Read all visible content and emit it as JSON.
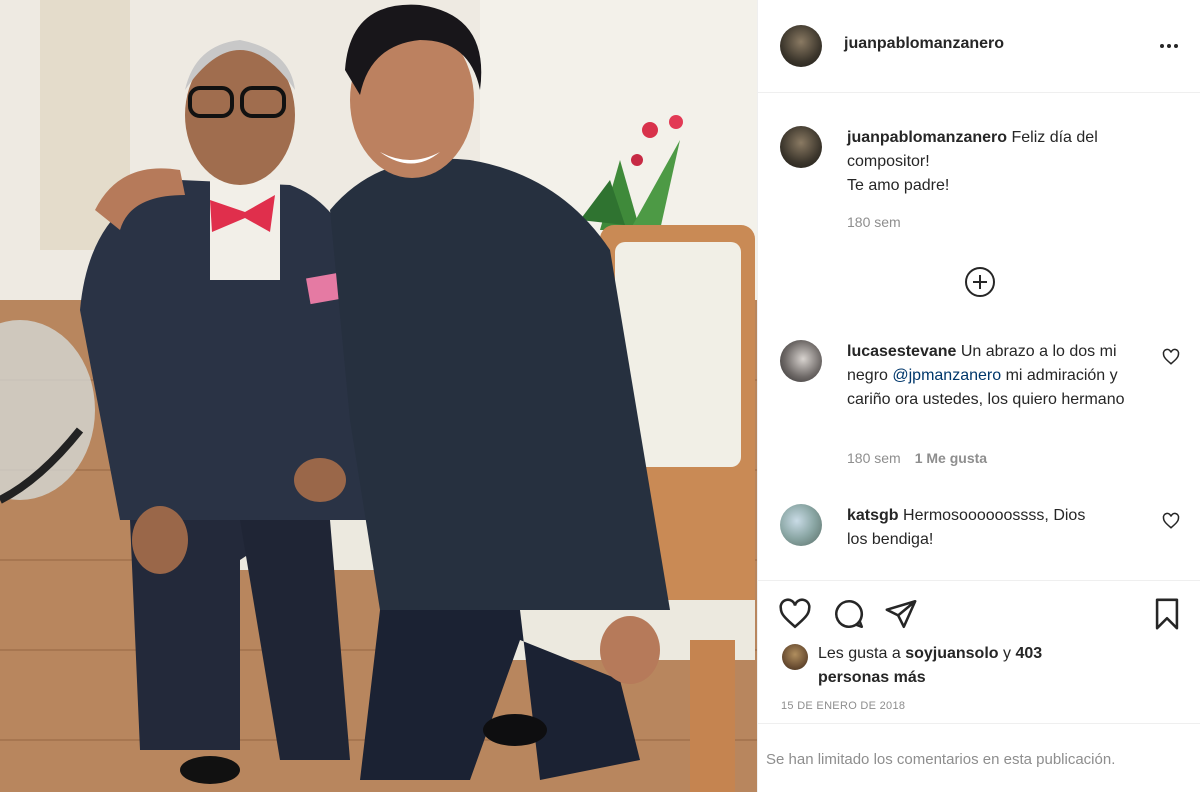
{
  "post": {
    "author": "juanpablomanzanero",
    "more_icon": "more-horizontal-icon"
  },
  "caption": {
    "username": "juanpablomanzanero",
    "text_line1": "Feliz día del",
    "text_line2": "compositor!",
    "text_line3": "Te amo padre!",
    "time": "180 sem"
  },
  "load_more_icon": "plus-circle-icon",
  "comments": [
    {
      "username": "lucasestevane",
      "text_before": "Un abrazo a lo dos mi negro",
      "mention": "@jpmanzanero",
      "text_after": "mi admiración y cariño ora ustedes, los quiero hermano",
      "time": "180 sem",
      "likes": "1 Me gusta"
    },
    {
      "username": "katsgb",
      "text": "Hermosoooooossss, Dios los bendiga!"
    }
  ],
  "likes": {
    "prefix": "Les gusta a",
    "liker": "soyjuansolo",
    "joiner": "y",
    "others": "403 personas más"
  },
  "date": "15 DE ENERO DE 2018",
  "footer": {
    "notice": "Se han limitado los comentarios en esta publicación."
  }
}
